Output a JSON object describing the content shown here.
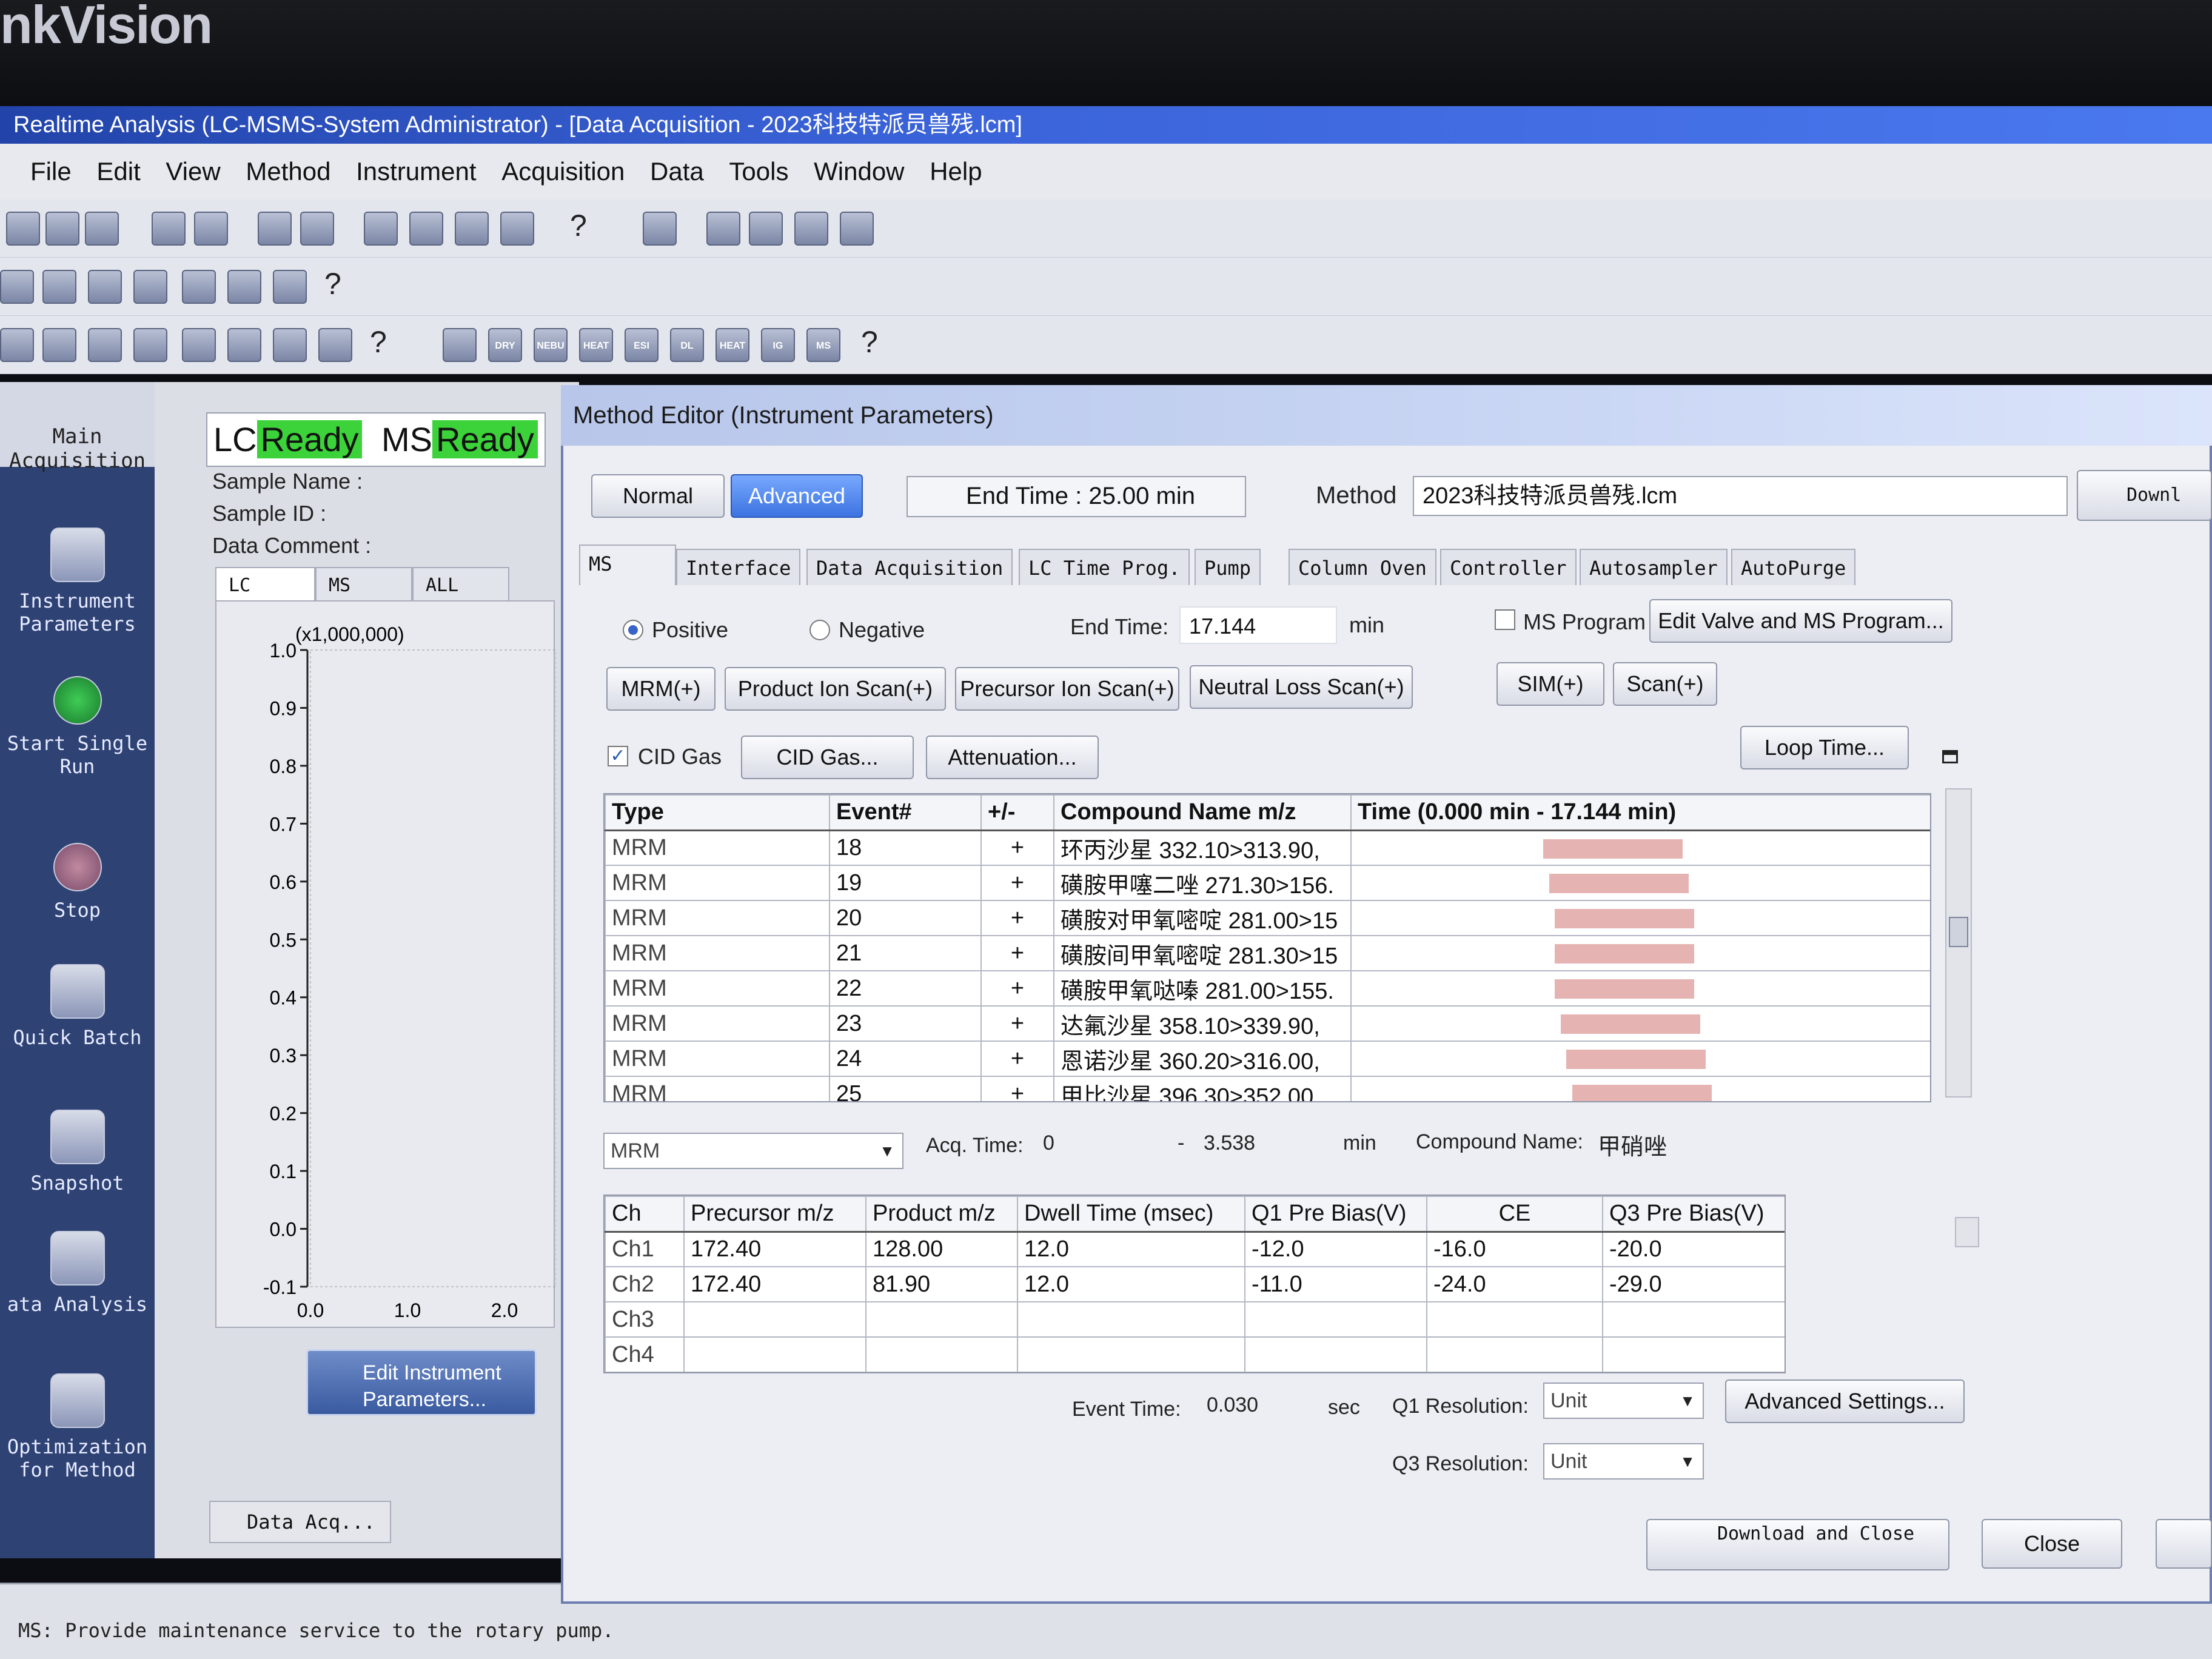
{
  "brand": "nkVision",
  "window": {
    "title": "Realtime Analysis (LC-MSMS-System Administrator) - [Data Acquisition - 2023科技特派员兽残.lcm]"
  },
  "menu": [
    "File",
    "Edit",
    "View",
    "Method",
    "Instrument",
    "Acquisition",
    "Data",
    "Tools",
    "Window",
    "Help"
  ],
  "toolbar2_icons": [
    "ESI",
    "DL",
    "HEAT",
    "IG"
  ],
  "toolbar2_labels": [
    "DRY",
    "NEBU",
    "HEAT",
    "ESI",
    "DL",
    "HEAT",
    "IG",
    "MS"
  ],
  "sidebar": {
    "header": [
      "Main",
      "Acquisition"
    ],
    "items": [
      {
        "label": "Instrument Parameters",
        "icon": "instrument-parameters-icon"
      },
      {
        "label": "Start Single Run",
        "icon": "start-icon"
      },
      {
        "label": "Stop",
        "icon": "stop-icon"
      },
      {
        "label": "Quick Batch",
        "icon": "quick-batch-icon"
      },
      {
        "label": "Snapshot",
        "icon": "snapshot-icon"
      },
      {
        "label": "ata Analysis",
        "icon": "data-analysis-icon"
      },
      {
        "label": "Optimization for Method",
        "icon": "optimization-icon"
      }
    ]
  },
  "status": {
    "lc_label": "LC",
    "lc_state": "Ready",
    "ms_label": "MS",
    "ms_state": "Ready",
    "sample_name": "Sample Name :",
    "sample_id": "Sample ID :",
    "data_comment": "Data Comment :",
    "tabs": [
      "LC",
      "MS",
      "ALL"
    ]
  },
  "chart_data": {
    "type": "line",
    "scale_label": "(x1,000,000)",
    "y_ticks": [
      "1.0",
      "0.9",
      "0.8",
      "0.7",
      "0.6",
      "0.5",
      "0.4",
      "0.3",
      "0.2",
      "0.1",
      "0.0",
      "-0.1"
    ],
    "x_ticks": [
      "0.0",
      "1.0",
      "2.0"
    ],
    "series": []
  },
  "edit_instrument_button": "Edit Instrument Parameters...",
  "data_acq_tab": "Data Acq...",
  "status_bar": "MS: Provide maintenance service to the rotary pump.",
  "dialog": {
    "title": "Method Editor (Instrument Parameters)",
    "mode_normal": "Normal",
    "mode_advanced": "Advanced",
    "end_time": "End Time : 25.00 min",
    "method_label": "Method",
    "method_value": "2023科技特派员兽残.lcm",
    "download_label": "Downl",
    "tabs": [
      "MS",
      "Interface",
      "Data Acquisition",
      "LC Time Prog.",
      "Pump",
      "Column Oven",
      "Controller",
      "Autosampler",
      "AutoPurge"
    ],
    "polarity_positive": "Positive",
    "polarity_negative": "Negative",
    "ms_end_time_label": "End Time:",
    "ms_end_time_value": "17.144",
    "ms_end_time_unit": "min",
    "ms_program_label": "MS Program",
    "edit_valve_btn": "Edit Valve and MS Program...",
    "scan_buttons": [
      "MRM(+)",
      "Product Ion Scan(+)",
      "Precursor Ion Scan(+)",
      "Neutral Loss Scan(+)",
      "SIM(+)",
      "Scan(+)"
    ],
    "cid_gas_check": "CID Gas",
    "cid_gas_btn": "CID Gas...",
    "attenuation_btn": "Attenuation...",
    "loop_time_btn": "Loop Time...",
    "event_table": {
      "headers": [
        "Type",
        "Event#",
        "+/-",
        "Compound Name   m/z",
        "Time (0.000 min - 17.144 min)"
      ],
      "rows": [
        {
          "type": "MRM",
          "event": "18",
          "pol": "+",
          "compound": "环丙沙星 332.10>313.90,",
          "start": 0.33,
          "width": 0.24
        },
        {
          "type": "MRM",
          "event": "19",
          "pol": "+",
          "compound": "磺胺甲噻二唑 271.30>156.",
          "start": 0.34,
          "width": 0.24
        },
        {
          "type": "MRM",
          "event": "20",
          "pol": "+",
          "compound": "磺胺对甲氧嘧啶 281.00>15",
          "start": 0.35,
          "width": 0.24
        },
        {
          "type": "MRM",
          "event": "21",
          "pol": "+",
          "compound": "磺胺间甲氧嘧啶 281.30>15",
          "start": 0.35,
          "width": 0.24
        },
        {
          "type": "MRM",
          "event": "22",
          "pol": "+",
          "compound": "磺胺甲氧哒嗪 281.00>155.",
          "start": 0.35,
          "width": 0.24
        },
        {
          "type": "MRM",
          "event": "23",
          "pol": "+",
          "compound": "达氟沙星 358.10>339.90,",
          "start": 0.36,
          "width": 0.24
        },
        {
          "type": "MRM",
          "event": "24",
          "pol": "+",
          "compound": "恩诺沙星 360.20>316.00,",
          "start": 0.37,
          "width": 0.24
        },
        {
          "type": "MRM",
          "event": "25",
          "pol": "+",
          "compound": "甲比沙星 396.30>352.00",
          "start": 0.38,
          "width": 0.24
        }
      ]
    },
    "event_type_select": "MRM",
    "acq_time_label": "Acq. Time:",
    "acq_time_start": "0",
    "acq_time_sep": "-",
    "acq_time_end": "3.538",
    "acq_time_unit": "min",
    "compound_name_label": "Compound Name:",
    "compound_name_value": "甲硝唑",
    "channel_table": {
      "headers": [
        "Ch",
        "Precursor m/z",
        "Product m/z",
        "Dwell Time (msec)",
        "Q1 Pre Bias(V)",
        "CE",
        "Q3 Pre Bias(V)"
      ],
      "rows": [
        [
          "Ch1",
          "172.40",
          "128.00",
          "12.0",
          "-12.0",
          "-16.0",
          "-20.0"
        ],
        [
          "Ch2",
          "172.40",
          "81.90",
          "12.0",
          "-11.0",
          "-24.0",
          "-29.0"
        ],
        [
          "Ch3",
          "",
          "",
          "",
          "",
          "",
          ""
        ],
        [
          "Ch4",
          "",
          "",
          "",
          "",
          "",
          ""
        ]
      ]
    },
    "event_time_label": "Event Time:",
    "event_time_value": "0.030",
    "event_time_unit": "sec",
    "q1_resolution_label": "Q1 Resolution:",
    "q1_resolution_value": "Unit",
    "q3_resolution_label": "Q3 Resolution:",
    "q3_resolution_value": "Unit",
    "advanced_settings_btn": "Advanced Settings...",
    "download_close_btn": "Download and Close",
    "close_btn": "Close"
  },
  "colors": {
    "ready_green": "#3bd23a",
    "title_blue": "#2244aa",
    "sidebar_navy": "#2f4274",
    "timebar": "#e6b3b3"
  }
}
